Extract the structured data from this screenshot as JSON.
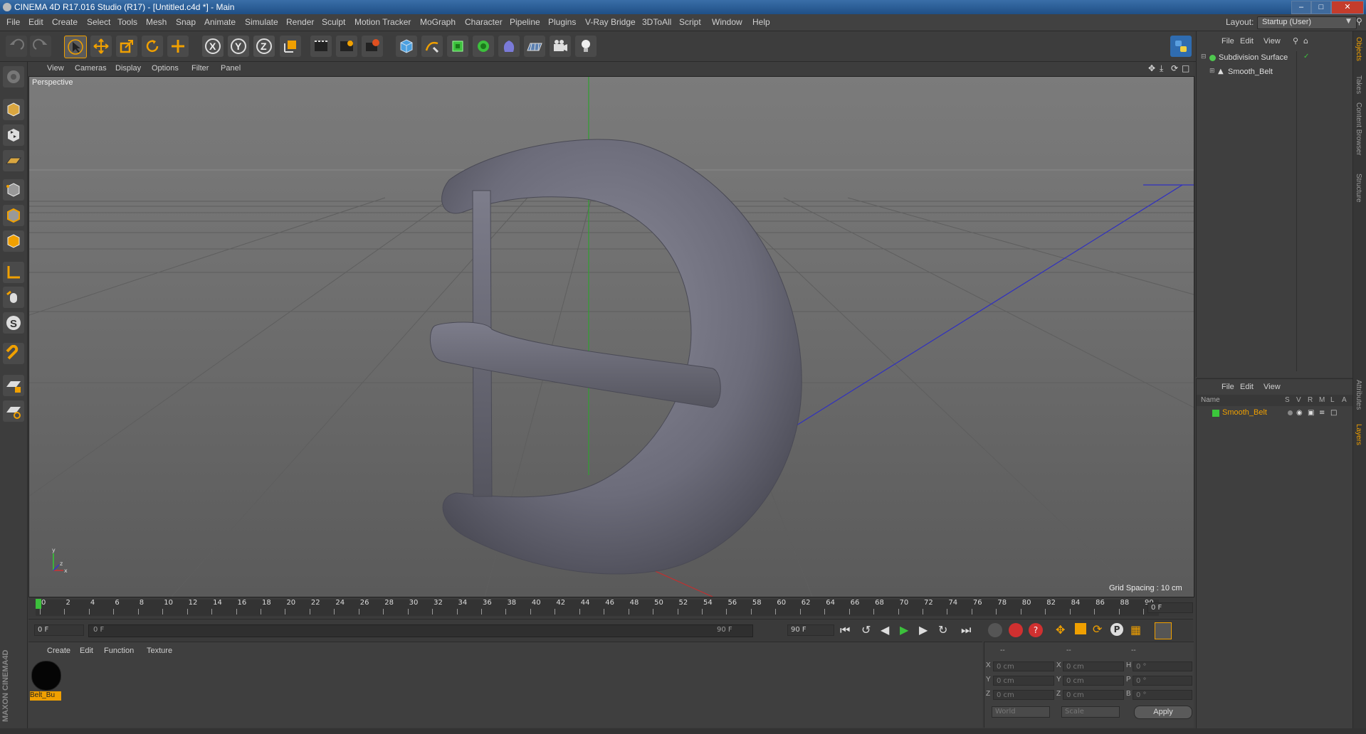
{
  "window": {
    "title": "CINEMA 4D R17.016 Studio (R17) - [Untitled.c4d *] - Main",
    "layout_label": "Layout:",
    "layout_value": "Startup (User)"
  },
  "menubar": [
    "File",
    "Edit",
    "Create",
    "Select",
    "Tools",
    "Mesh",
    "Snap",
    "Animate",
    "Simulate",
    "Render",
    "Sculpt",
    "Motion Tracker",
    "MoGraph",
    "Character",
    "Pipeline",
    "Plugins",
    "V-Ray Bridge",
    "3DToAll",
    "Script",
    "Window",
    "Help"
  ],
  "toolbar": {
    "icons": [
      "undo-icon",
      "redo-icon",
      "select-arrow-icon",
      "move-icon",
      "scale-icon",
      "rotate-icon",
      "transform-icon",
      "x-axis-icon",
      "y-axis-icon",
      "z-axis-icon",
      "coordinate-system-icon",
      "render-view-icon",
      "render-picture-viewer-icon",
      "render-settings-icon",
      "cube-icon",
      "pen-spline-icon",
      "nurbs-icon",
      "array-icon",
      "deformer-icon",
      "floor-icon",
      "camera-icon",
      "light-icon"
    ],
    "axis_labels": [
      "X",
      "Y",
      "Z"
    ]
  },
  "viewport": {
    "menu": [
      "View",
      "Cameras",
      "Display",
      "Options",
      "Filter",
      "Panel"
    ],
    "label": "Perspective",
    "grid_spacing": "Grid Spacing : 10 cm",
    "axis_gizmo": {
      "y": "y",
      "x": "x",
      "z": "z"
    }
  },
  "timeline": {
    "ticks": [
      "0",
      "2",
      "4",
      "6",
      "8",
      "10",
      "12",
      "14",
      "16",
      "18",
      "20",
      "22",
      "24",
      "26",
      "28",
      "30",
      "32",
      "34",
      "36",
      "38",
      "40",
      "42",
      "44",
      "46",
      "48",
      "50",
      "52",
      "54",
      "56",
      "58",
      "60",
      "62",
      "64",
      "66",
      "68",
      "70",
      "72",
      "74",
      "76",
      "78",
      "80",
      "82",
      "84",
      "86",
      "88",
      "90"
    ],
    "current_frame": "0 F",
    "start_field": "0 F",
    "range_start": "0 F",
    "range_end": "90 F",
    "end_field": "90 F"
  },
  "material_panel": {
    "menu": [
      "Create",
      "Edit",
      "Function",
      "Texture"
    ],
    "materials": [
      {
        "name": "Belt_Bu"
      }
    ],
    "brand": "MAXON CINEMA4D"
  },
  "coordinates": {
    "header": [
      "--",
      "--",
      "--"
    ],
    "rows": [
      {
        "a": "X",
        "a_val": "0 cm",
        "b": "X",
        "b_val": "0 cm",
        "c": "H",
        "c_val": "0 °"
      },
      {
        "a": "Y",
        "a_val": "0 cm",
        "b": "Y",
        "b_val": "0 cm",
        "c": "P",
        "c_val": "0 °"
      },
      {
        "a": "Z",
        "a_val": "0 cm",
        "b": "Z",
        "b_val": "0 cm",
        "c": "B",
        "c_val": "0 °"
      }
    ],
    "mode1": "World",
    "mode2": "Scale",
    "apply": "Apply"
  },
  "object_manager": {
    "menu": [
      "File",
      "Edit",
      "View"
    ],
    "objects": [
      {
        "name": "Subdivision Surface",
        "color": "#4fc84f"
      },
      {
        "name": "Smooth_Belt",
        "color": "#c8c8c8"
      }
    ]
  },
  "layer_manager": {
    "menu": [
      "File",
      "Edit",
      "View"
    ],
    "columns": [
      "Name",
      "S",
      "V",
      "R",
      "M",
      "L",
      "A"
    ],
    "layers": [
      {
        "name": "Smooth_Belt",
        "color": "#3bc63b"
      }
    ]
  },
  "side_tabs": [
    "Objects",
    "Takes",
    "Content Browser",
    "Structure",
    "Attributes",
    "Layers"
  ],
  "colors": {
    "accent": "#f0a000",
    "bg": "#3c3c3c",
    "selected_text": "#f0a000"
  }
}
